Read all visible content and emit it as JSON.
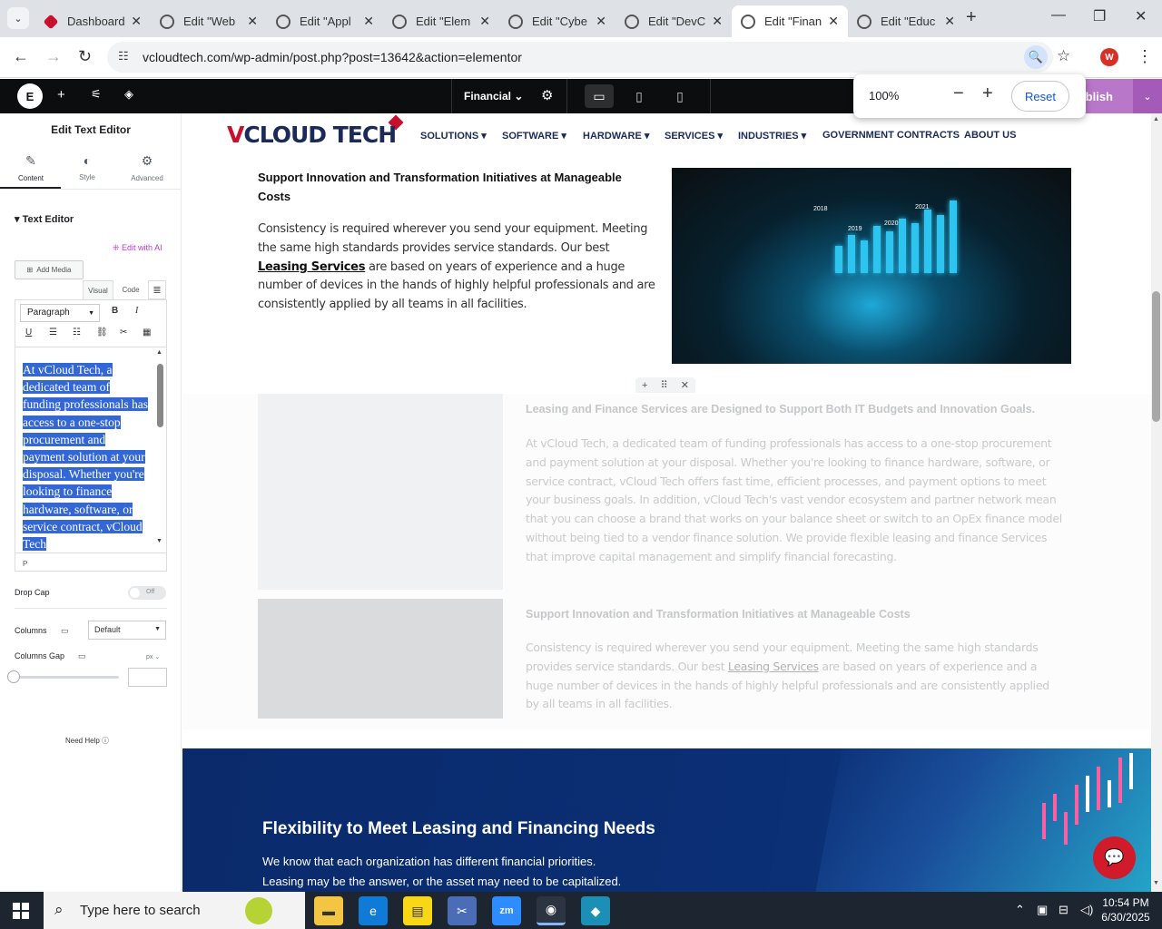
{
  "browser": {
    "tabs": [
      {
        "title": "Dashboard",
        "active": false
      },
      {
        "title": "Edit \"Web",
        "active": false
      },
      {
        "title": "Edit \"Appl",
        "active": false
      },
      {
        "title": "Edit \"Elem",
        "active": false
      },
      {
        "title": "Edit \"Cybe",
        "active": false
      },
      {
        "title": "Edit \"DevC",
        "active": false
      },
      {
        "title": "Edit \"Finan",
        "active": true
      },
      {
        "title": "Edit \"Educ",
        "active": false
      }
    ],
    "url": "vcloudtech.com/wp-admin/post.php?post=13642&action=elementor",
    "profile_initial": "W"
  },
  "zoom_popup": {
    "level": "100%",
    "reset_label": "Reset"
  },
  "elementor": {
    "document_title": "Financial",
    "publish_label": "Publish",
    "panel": {
      "title": "Edit Text Editor",
      "tabs": [
        "Content",
        "Style",
        "Advanced"
      ],
      "section_title": "Text Editor",
      "edit_ai": "Edit with AI",
      "add_media": "Add Media",
      "visual_tab": "Visual",
      "code_tab": "Code",
      "format": "Paragraph",
      "editor_text": "At vCloud Tech, a dedicated team of funding professionals has access to a one-stop procurement and payment solution at your disposal. Whether you're looking to finance hardware, software, or service contract, vCloud Tech",
      "status_path": "P",
      "drop_cap_label": "Drop Cap",
      "drop_cap_value": "Off",
      "columns_label": "Columns",
      "columns_value": "Default",
      "columns_gap_label": "Columns Gap",
      "columns_gap_unit": "px",
      "need_help": "Need Help"
    }
  },
  "site": {
    "logo": {
      "part1": "V",
      "part2": "CLOUD TECH"
    },
    "menu": [
      {
        "label": "SOLUTIONS",
        "dropdown": true
      },
      {
        "label": "SOFTWARE",
        "dropdown": true
      },
      {
        "label": "HARDWARE",
        "dropdown": true
      },
      {
        "label": "SERVICES",
        "dropdown": true
      },
      {
        "label": "INDUSTRIES",
        "dropdown": true
      },
      {
        "label": "GOVERNMENT CONTRACTS",
        "dropdown": false
      },
      {
        "label": "ABOUT US",
        "dropdown": false
      }
    ],
    "section1": {
      "heading": "Support Innovation and Transformation Initiatives at Manageable Costs",
      "p_before": "Consistency is required wherever you send your equipment. Meeting the same high standards provides service standards. Our best ",
      "link": "Leasing Services",
      "p_after": " are based on years of experience and a huge number of devices in the hands of highly helpful professionals and are consistently applied by all teams in all facilities.",
      "chart_years": [
        "2018",
        "2019",
        "2020",
        "2021"
      ]
    },
    "section2": {
      "heading": "Leasing and Finance Services are Designed to Support Both IT Budgets and Innovation Goals.",
      "text": "At vCloud Tech, a dedicated team of funding professionals has access to a one-stop procurement and payment solution at your disposal. Whether you're looking to finance hardware, software, or service contract, vCloud Tech offers fast time, efficient processes, and payment options to meet your business goals. In addition, vCloud Tech's vast vendor ecosystem and partner network mean that you can choose a brand that works on your balance sheet or switch to an OpEx finance model without being tied to a vendor finance solution. We provide flexible leasing and finance Services that improve capital management and simplify financial forecasting."
    },
    "section3": {
      "heading": "Support Innovation and Transformation Initiatives at Manageable Costs",
      "p_before": "Consistency is required wherever you send your equipment. Meeting the same high standards provides service standards. Our best ",
      "link": "Leasing Services",
      "p_after": " are based on years of experience and a huge number of devices in the hands of highly helpful professionals and are consistently applied by all teams in all facilities."
    },
    "section4": {
      "heading": "Flexibility to Meet Leasing and Financing Needs",
      "line1": "We know that each organization has different financial priorities.",
      "line2": "Leasing may be the answer, or the asset may need to be capitalized."
    }
  },
  "taskbar": {
    "search_placeholder": "Type here to search",
    "time": "10:54 PM",
    "date": "6/30/2025"
  }
}
